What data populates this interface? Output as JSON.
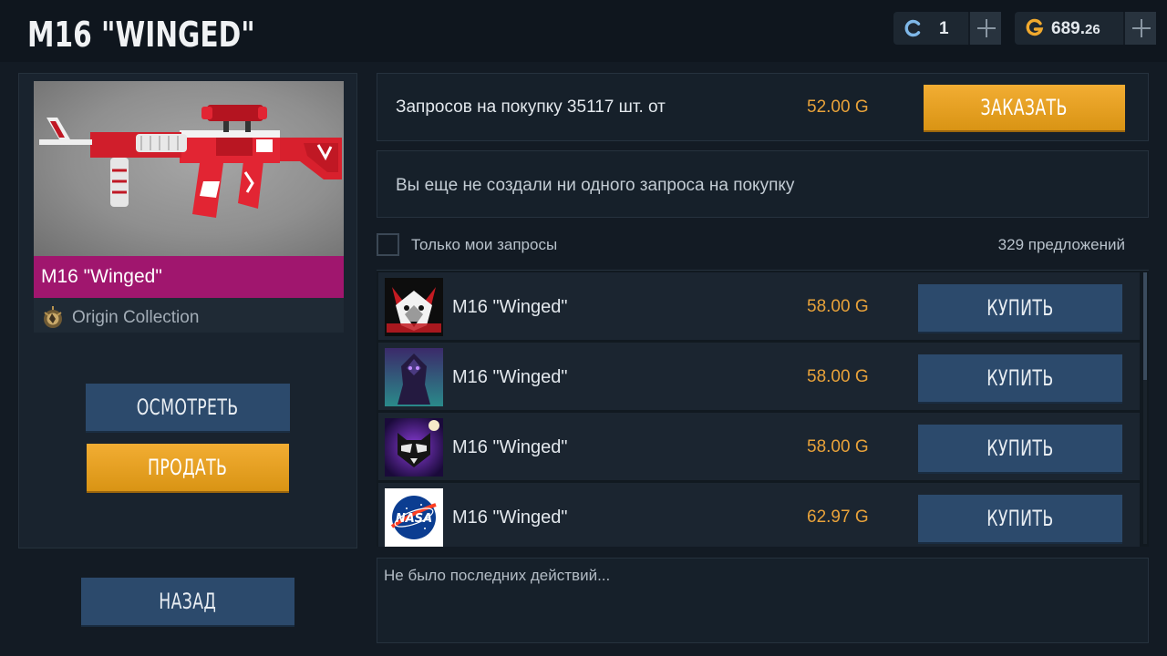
{
  "header": {
    "title": "M16 \"WINGED\"",
    "credits": "1",
    "gold_main": "689.",
    "gold_frac": "26"
  },
  "item": {
    "name": "M16 \"Winged\"",
    "collection": "Origin Collection",
    "rarity_color": "#a0166e"
  },
  "actions": {
    "inspect": "ОСМОТРЕТЬ",
    "sell": "ПРОДАТЬ",
    "back": "НАЗАД"
  },
  "order": {
    "text": "Запросов на покупку 35117 шт. от",
    "price": "52.00 G",
    "button": "ЗАКАЗАТЬ"
  },
  "requests": {
    "empty": "Вы еще не создали ни одного запроса на покупку"
  },
  "filter": {
    "label": "Только мои запросы",
    "offers": "329 предложений"
  },
  "offers": [
    {
      "name": "M16 \"Winged\"",
      "price": "58.00 G",
      "button": "КУПИТЬ",
      "avatar": "wolf-avatar"
    },
    {
      "name": "M16 \"Winged\"",
      "price": "58.00 G",
      "button": "КУПИТЬ",
      "avatar": "raven-avatar"
    },
    {
      "name": "M16 \"Winged\"",
      "price": "58.00 G",
      "button": "КУПИТЬ",
      "avatar": "raccoon-avatar"
    },
    {
      "name": "M16 \"Winged\"",
      "price": "62.97 G",
      "button": "КУПИТЬ",
      "avatar": "nasa-avatar"
    }
  ],
  "activity": {
    "text": "Не было последних действий..."
  },
  "colors": {
    "accent_orange": "#e8a23a",
    "button_blue": "#2c4a6c",
    "background": "#131b24"
  }
}
